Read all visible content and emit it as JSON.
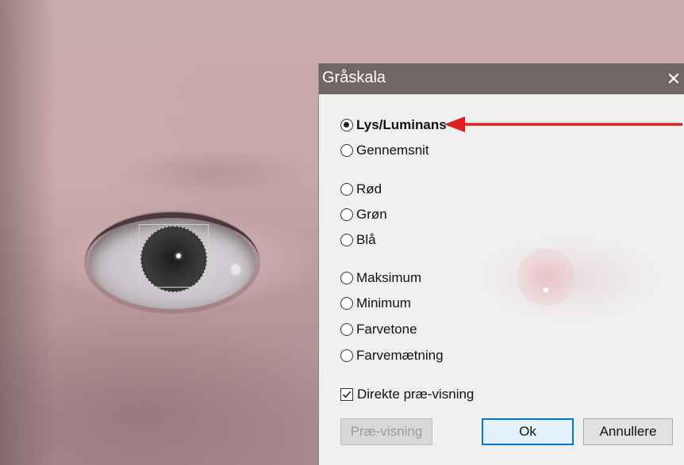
{
  "dialog": {
    "title": "Gråskala",
    "close_symbol": "✕",
    "options_group1": [
      {
        "label": "Lys/Luminans",
        "checked": true
      },
      {
        "label": "Gennemsnit",
        "checked": false
      }
    ],
    "options_group2": [
      {
        "label": "Rød",
        "checked": false
      },
      {
        "label": "Grøn",
        "checked": false
      },
      {
        "label": "Blå",
        "checked": false
      }
    ],
    "options_group3": [
      {
        "label": "Maksimum",
        "checked": false
      },
      {
        "label": "Minimum",
        "checked": false
      },
      {
        "label": "Farvetone",
        "checked": false
      },
      {
        "label": "Farvemætning",
        "checked": false
      }
    ],
    "direct_preview": {
      "label": "Direkte præ-visning",
      "checked": true
    },
    "buttons": {
      "preview": "Præ-visning",
      "ok": "Ok",
      "cancel": "Annullere"
    }
  },
  "annotation": {
    "arrow_color": "#e02020",
    "icon": "red-arrow-icon"
  },
  "colors": {
    "titlebar": "#706664",
    "dialog_bg": "#f0f0f0",
    "default_button_border": "#0078d7"
  }
}
